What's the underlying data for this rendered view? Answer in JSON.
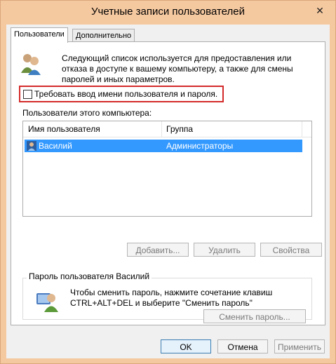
{
  "window": {
    "title": "Учетные записи пользователей",
    "close_glyph": "✕"
  },
  "tabs": [
    {
      "label": "Пользователи",
      "active": true
    },
    {
      "label": "Дополнительно",
      "active": false
    }
  ],
  "users_tab": {
    "description": "Следующий список используется для предоставления или отказа в доступе к вашему компьютеру, а также для смены паролей и иных параметров.",
    "require_login_checkbox": {
      "label": "Требовать ввод имени пользователя и пароля.",
      "checked": false
    },
    "list_caption": "Пользователи этого компьютера:",
    "columns": [
      "Имя пользователя",
      "Группа"
    ],
    "rows": [
      {
        "name": "Василий",
        "group": "Администраторы",
        "selected": true
      }
    ],
    "buttons": {
      "add": "Добавить...",
      "remove": "Удалить",
      "properties": "Свойства"
    },
    "password_group": {
      "title": "Пароль пользователя Василий",
      "text": "Чтобы сменить пароль, нажмите сочетание клавиш CTRL+ALT+DEL и выберите \"Сменить пароль\"",
      "button": "Сменить пароль..."
    }
  },
  "dialog_buttons": {
    "ok": "OK",
    "cancel": "Отмена",
    "apply": "Применить"
  },
  "colors": {
    "titlebar": "#f5c9a0",
    "selection": "#3399ff",
    "highlight_border": "#d42a2a"
  },
  "icons": {
    "users": "users-icon",
    "user_row": "user-icon",
    "password": "key-user-icon",
    "close": "close-icon"
  }
}
